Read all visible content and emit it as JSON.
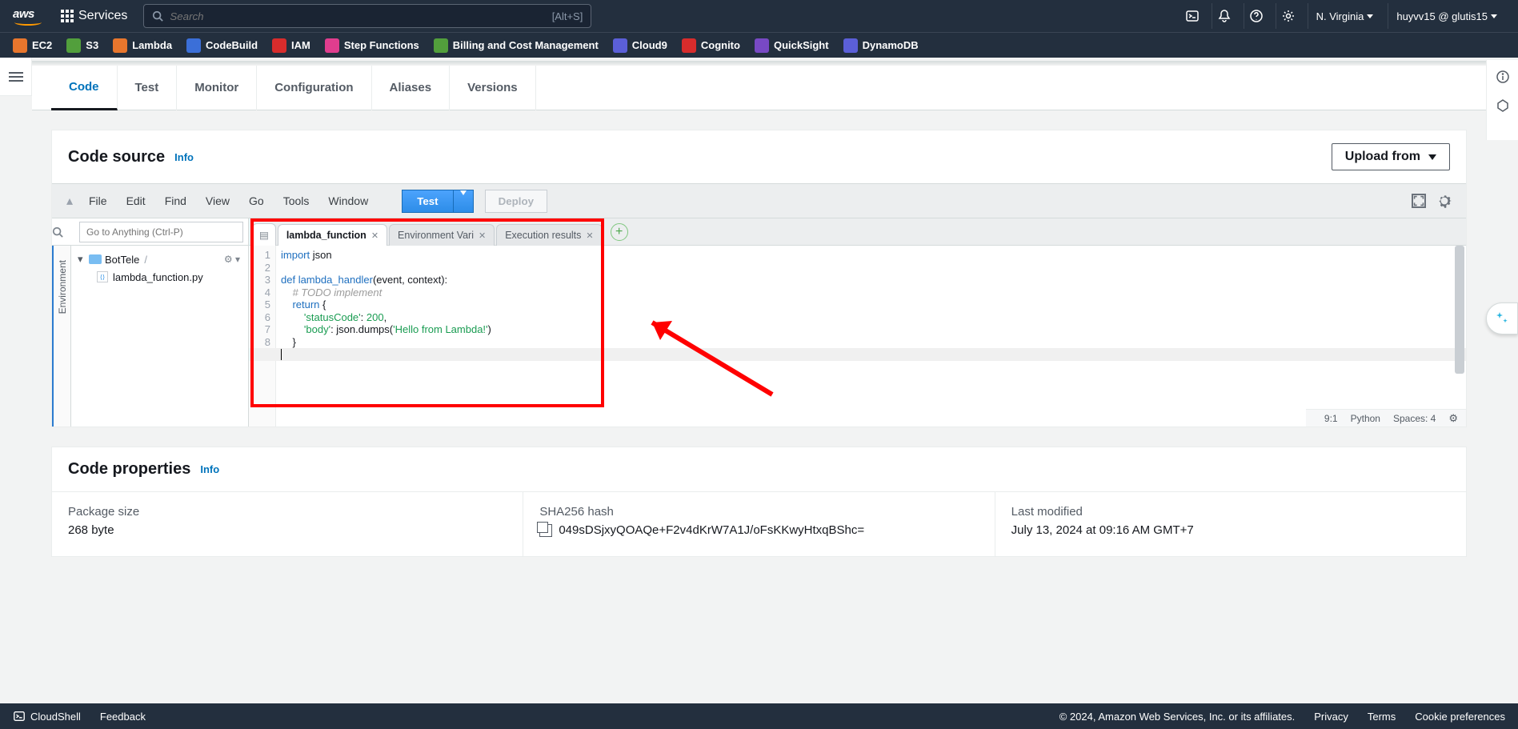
{
  "topnav": {
    "services_label": "Services",
    "search_placeholder": "Search",
    "search_kbd": "[Alt+S]",
    "region": "N. Virginia",
    "account": "huyvv15 @ glutis15"
  },
  "svcbar": [
    "EC2",
    "S3",
    "Lambda",
    "CodeBuild",
    "IAM",
    "Step Functions",
    "Billing and Cost Management",
    "Cloud9",
    "Cognito",
    "QuickSight",
    "DynamoDB"
  ],
  "tabs": [
    "Code",
    "Test",
    "Monitor",
    "Configuration",
    "Aliases",
    "Versions"
  ],
  "code_source": {
    "title": "Code source",
    "info": "Info",
    "upload": "Upload from"
  },
  "ide_menu": [
    "File",
    "Edit",
    "Find",
    "View",
    "Go",
    "Tools",
    "Window"
  ],
  "ide_buttons": {
    "test": "Test",
    "deploy": "Deploy"
  },
  "go_anything_placeholder": "Go to Anything (Ctrl-P)",
  "project": {
    "name": "BotTele",
    "file": "lambda_function.py"
  },
  "editor_tabs": {
    "t1": "lambda_function",
    "t2": "Environment Vari",
    "t3": "Execution results"
  },
  "code_lines": {
    "l1a": "import",
    "l1b": " json",
    "l3a": "def",
    "l3b": " lambda_handler",
    "l3c": "(event, context):",
    "l4": "    # TODO implement",
    "l5a": "    ",
    "l5b": "return",
    "l5c": " {",
    "l6a": "        ",
    "l6b": "'statusCode'",
    "l6c": ": ",
    "l6d": "200",
    "l6e": ",",
    "l7a": "        ",
    "l7b": "'body'",
    "l7c": ": json.",
    "l7d": "dumps",
    "l7e": "(",
    "l7f": "'Hello from Lambda!'",
    "l7g": ")",
    "l8": "    }"
  },
  "status": {
    "pos": "9:1",
    "lang": "Python",
    "spaces": "Spaces: 4"
  },
  "code_props": {
    "title": "Code properties",
    "info": "Info",
    "c1l": "Package size",
    "c1v": "268 byte",
    "c2l": "SHA256 hash",
    "c2v": "049sDSjxyQOAQe+F2v4dKrW7A1J/oFsKKwyHtxqBShc=",
    "c3l": "Last modified",
    "c3v": "July 13, 2024 at 09:16 AM GMT+7"
  },
  "bottombar": {
    "cloudshell": "CloudShell",
    "feedback": "Feedback",
    "copyright": "© 2024, Amazon Web Services, Inc. or its affiliates.",
    "privacy": "Privacy",
    "terms": "Terms",
    "cookie": "Cookie preferences"
  }
}
